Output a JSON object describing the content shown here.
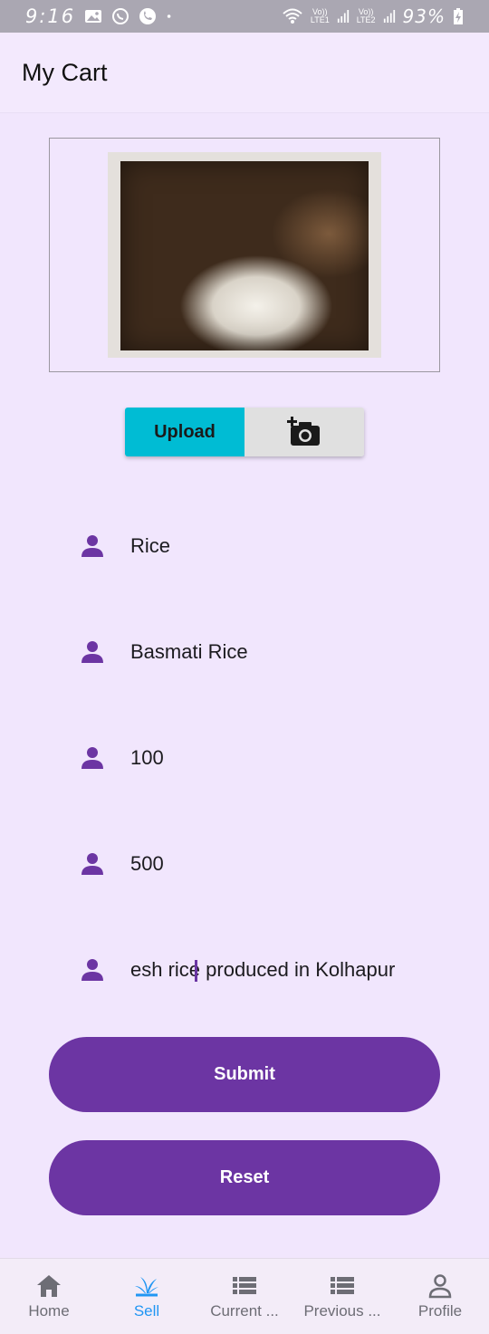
{
  "status_bar": {
    "time": "9:16",
    "battery": "93%",
    "sim1": "LTE1",
    "sim2": "LTE2",
    "volte": "Vo))"
  },
  "app_bar": {
    "title": "My Cart"
  },
  "image_upload": {
    "upload_label": "Upload"
  },
  "form": {
    "fields": [
      {
        "value": "Rice",
        "icon": "person-icon"
      },
      {
        "value": "Basmati Rice",
        "icon": "person-icon"
      },
      {
        "value": "100",
        "icon": "person-icon"
      },
      {
        "value": "500",
        "icon": "person-icon"
      },
      {
        "value": "esh rice produced in Kolhapur",
        "icon": "person-icon"
      }
    ],
    "submit_label": "Submit",
    "reset_label": "Reset"
  },
  "bottom_nav": {
    "items": [
      {
        "label": "Home",
        "icon": "home-icon"
      },
      {
        "label": "Sell",
        "icon": "sprout-icon",
        "active": true
      },
      {
        "label": "Current ...",
        "icon": "list-icon"
      },
      {
        "label": "Previous ...",
        "icon": "list-icon"
      },
      {
        "label": "Profile",
        "icon": "profile-icon"
      }
    ]
  },
  "colors": {
    "background": "#f1e6fd",
    "primary": "#6c35a3",
    "upload": "#00bcd4",
    "nav_active": "#2196f3"
  }
}
